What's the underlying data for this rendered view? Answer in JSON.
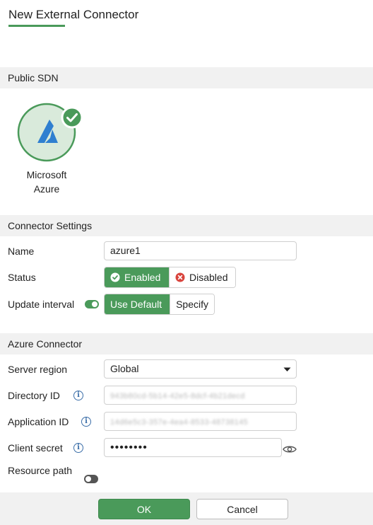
{
  "header": {
    "title": "New External Connector"
  },
  "public_sdn": {
    "section_title": "Public SDN",
    "connector": {
      "name_line1": "Microsoft",
      "name_line2": "Azure",
      "selected": true
    }
  },
  "connector_settings": {
    "section_title": "Connector Settings",
    "name_label": "Name",
    "name_value": "azure1",
    "status_label": "Status",
    "status_enabled": "Enabled",
    "status_disabled": "Disabled",
    "update_interval_label": "Update interval",
    "update_use_default": "Use Default",
    "update_specify": "Specify"
  },
  "azure_connector": {
    "section_title": "Azure Connector",
    "server_region_label": "Server region",
    "server_region_value": "Global",
    "directory_id_label": "Directory ID",
    "directory_id_value": "943b80cd-5b14-42e5-8dcf-4b21decd",
    "application_id_label": "Application ID",
    "application_id_value": "14d6e5c3-357e-4ea4-8533-48738145",
    "client_secret_label": "Client secret",
    "client_secret_value": "••••••••",
    "resource_path_label": "Resource path"
  },
  "footer": {
    "ok_label": "OK",
    "cancel_label": "Cancel"
  },
  "colors": {
    "accent": "#4a9a5a",
    "section_bg": "#f1f1f1",
    "disabled_red": "#d9443d",
    "info_blue": "#3b6ea8",
    "azure_blue": "#2f7fd0"
  }
}
